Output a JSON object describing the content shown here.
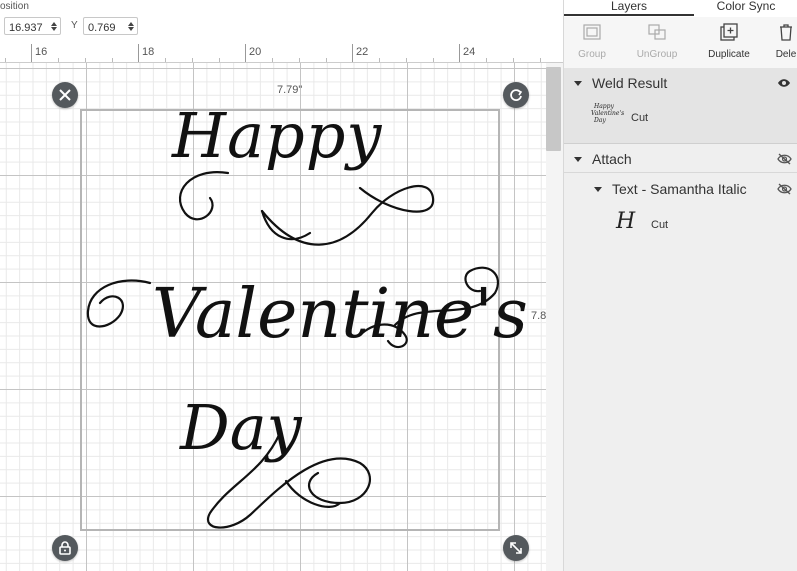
{
  "position": {
    "label": "osition",
    "x_value": "16.937",
    "y_label": "Y",
    "y_value": "0.769"
  },
  "ruler": {
    "labels": [
      "16",
      "18",
      "20",
      "22",
      "24"
    ]
  },
  "canvas": {
    "width_dim": "7.79\"",
    "height_dim": "7.8",
    "design_text": {
      "line1": "Happy",
      "line2": "Valentine's",
      "line3": "Day"
    }
  },
  "panel": {
    "tabs": [
      "Layers",
      "Color Sync"
    ],
    "tools": {
      "group": "Group",
      "ungroup": "UnGroup",
      "duplicate": "Duplicate",
      "delete": "Dele"
    },
    "layers": {
      "weld_result": {
        "title": "Weld Result",
        "item_label": "Cut",
        "thumb_lines": [
          "Happy",
          "Valentine's",
          "Day"
        ]
      },
      "attach": {
        "title": "Attach"
      },
      "text_layer": {
        "title": "Text - Samantha Italic",
        "item_label": "Cut",
        "thumb_glyph": "H"
      }
    }
  },
  "colors": {
    "handle": "#54595d",
    "selection_border": "#b5b5b5",
    "panel_bg": "#efefef"
  }
}
